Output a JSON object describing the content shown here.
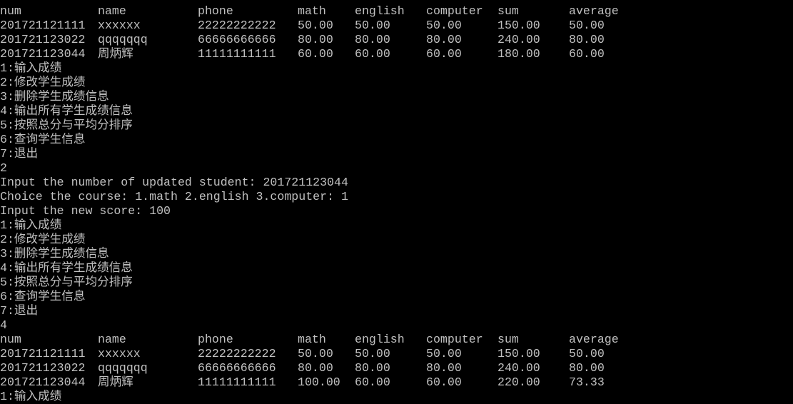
{
  "text_color": "#c0c0c0",
  "background": "#000000",
  "table_columns": [
    "num",
    "name",
    "phone",
    "math",
    "english",
    "computer",
    "sum",
    "average"
  ],
  "menu": [
    "1:输入成绩",
    "2:修改学生成绩",
    "3:删除学生成绩信息",
    "4:输出所有学生成绩信息",
    "5:按照总分与平均分排序",
    "6:查询学生信息",
    "7:退出"
  ],
  "blocks": [
    {
      "type": "text",
      "lines": [
        "4"
      ]
    },
    {
      "type": "table",
      "rows": [
        [
          "201721121111",
          "xxxxxx",
          "22222222222",
          "50.00",
          "50.00",
          "50.00",
          "150.00",
          "50.00"
        ],
        [
          "201721123022",
          "qqqqqqq",
          "66666666666",
          "80.00",
          "80.00",
          "80.00",
          "240.00",
          "80.00"
        ],
        [
          "201721123044",
          "周炳辉",
          "11111111111",
          "60.00",
          "60.00",
          "60.00",
          "180.00",
          "60.00"
        ]
      ]
    },
    {
      "type": "menu"
    },
    {
      "type": "text",
      "lines": [
        "2",
        "Input the number of updated student: 201721123044",
        "Choice the course: 1.math 2.english 3.computer: 1",
        "Input the new score: 100"
      ]
    },
    {
      "type": "menu"
    },
    {
      "type": "text",
      "lines": [
        "4"
      ]
    },
    {
      "type": "table",
      "rows": [
        [
          "201721121111",
          "xxxxxx",
          "22222222222",
          "50.00",
          "50.00",
          "50.00",
          "150.00",
          "50.00"
        ],
        [
          "201721123022",
          "qqqqqqq",
          "66666666666",
          "80.00",
          "80.00",
          "80.00",
          "240.00",
          "80.00"
        ],
        [
          "201721123044",
          "周炳辉",
          "11111111111",
          "100.00",
          "60.00",
          "60.00",
          "220.00",
          "73.33"
        ]
      ]
    },
    {
      "type": "text",
      "lines": [
        "1:输入成绩"
      ]
    }
  ]
}
